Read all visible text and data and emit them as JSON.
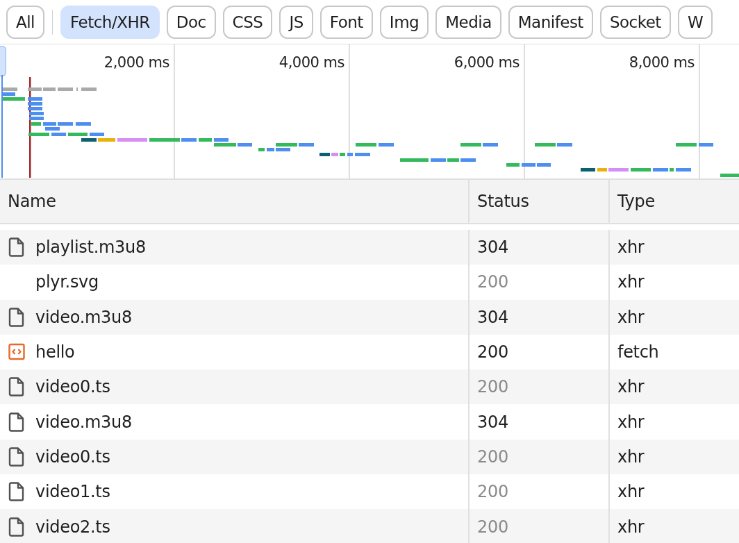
{
  "filters": [
    {
      "label": "All",
      "selected": false
    },
    {
      "label": "Fetch/XHR",
      "selected": true
    },
    {
      "label": "Doc",
      "selected": false
    },
    {
      "label": "CSS",
      "selected": false
    },
    {
      "label": "JS",
      "selected": false
    },
    {
      "label": "Font",
      "selected": false
    },
    {
      "label": "Img",
      "selected": false
    },
    {
      "label": "Media",
      "selected": false
    },
    {
      "label": "Manifest",
      "selected": false
    },
    {
      "label": "Socket",
      "selected": false
    },
    {
      "label": "W",
      "selected": false
    }
  ],
  "timeline": {
    "ticks": [
      "2,000 ms",
      "4,000 ms",
      "6,000 ms",
      "8,000 ms"
    ]
  },
  "table": {
    "columns": [
      "Name",
      "Status",
      "Type"
    ],
    "rows": [
      {
        "kind": "file",
        "name": "playlist.m3u8",
        "status": "304",
        "cached": false,
        "type": "xhr"
      },
      {
        "kind": "plain",
        "name": "plyr.svg",
        "status": "200",
        "cached": true,
        "type": "xhr"
      },
      {
        "kind": "file",
        "name": "video.m3u8",
        "status": "304",
        "cached": false,
        "type": "xhr"
      },
      {
        "kind": "script",
        "name": "hello",
        "status": "200",
        "cached": false,
        "type": "fetch"
      },
      {
        "kind": "file",
        "name": "video0.ts",
        "status": "200",
        "cached": true,
        "type": "xhr"
      },
      {
        "kind": "file",
        "name": "video.m3u8",
        "status": "304",
        "cached": false,
        "type": "xhr"
      },
      {
        "kind": "file",
        "name": "video0.ts",
        "status": "200",
        "cached": true,
        "type": "xhr"
      },
      {
        "kind": "file",
        "name": "video1.ts",
        "status": "200",
        "cached": true,
        "type": "xhr"
      },
      {
        "kind": "file",
        "name": "video2.ts",
        "status": "200",
        "cached": true,
        "type": "xhr"
      }
    ]
  }
}
